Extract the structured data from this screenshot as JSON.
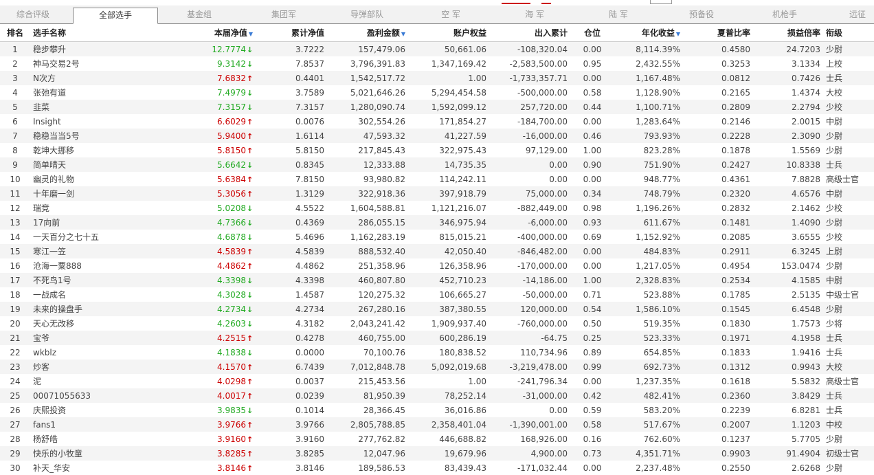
{
  "tabs": [
    {
      "label": "综合评级",
      "active": false
    },
    {
      "label": "全部选手",
      "active": true
    },
    {
      "label": "基金组",
      "active": false
    },
    {
      "label": "集团军",
      "active": false
    },
    {
      "label": "导弹部队",
      "active": false
    },
    {
      "label": "空 军",
      "active": false
    },
    {
      "label": "海 军",
      "active": false
    },
    {
      "label": "陆 军",
      "active": false
    },
    {
      "label": "预备役",
      "active": false
    },
    {
      "label": "机枪手",
      "active": false
    },
    {
      "label": "远征",
      "active": false
    }
  ],
  "columns": [
    {
      "label": "排名",
      "sortable": false
    },
    {
      "label": "选手名称",
      "sortable": false
    },
    {
      "label": "本届净值",
      "sortable": true
    },
    {
      "label": "累计净值",
      "sortable": false
    },
    {
      "label": "盈利金额",
      "sortable": true
    },
    {
      "label": "账户权益",
      "sortable": false
    },
    {
      "label": "出入累计",
      "sortable": false
    },
    {
      "label": "仓位",
      "sortable": false
    },
    {
      "label": "年化收益",
      "sortable": true
    },
    {
      "label": "夏普比率",
      "sortable": false
    },
    {
      "label": "损益倍率",
      "sortable": false
    },
    {
      "label": "衔级",
      "sortable": false
    }
  ],
  "sort_icon": "triangle-down",
  "trend_colors": {
    "up": "#cc0000",
    "down": "#22aa22"
  },
  "rows": [
    {
      "rank": "1",
      "name": "稳步攀升",
      "nav": "12.7774",
      "trend": "down",
      "cum_nav": "3.7222",
      "profit": "157,479.06",
      "equity": "50,661.06",
      "flow": "-108,320.04",
      "position": "0.00",
      "annual": "8,114.39%",
      "sharpe": "0.4580",
      "pl_ratio": "24.7203",
      "rank_title": "少尉"
    },
    {
      "rank": "2",
      "name": "神马交易2号",
      "nav": "9.3142",
      "trend": "down",
      "cum_nav": "7.8537",
      "profit": "3,796,391.83",
      "equity": "1,347,169.42",
      "flow": "-2,583,500.00",
      "position": "0.95",
      "annual": "2,432.55%",
      "sharpe": "0.3253",
      "pl_ratio": "3.1334",
      "rank_title": "上校"
    },
    {
      "rank": "3",
      "name": "N次方",
      "nav": "7.6832",
      "trend": "up",
      "cum_nav": "0.4401",
      "profit": "1,542,517.72",
      "equity": "1.00",
      "flow": "-1,733,357.71",
      "position": "0.00",
      "annual": "1,167.48%",
      "sharpe": "0.0812",
      "pl_ratio": "0.7426",
      "rank_title": "士兵"
    },
    {
      "rank": "4",
      "name": "张弛有道",
      "nav": "7.4979",
      "trend": "down",
      "cum_nav": "3.7589",
      "profit": "5,021,646.26",
      "equity": "5,294,454.58",
      "flow": "-500,000.00",
      "position": "0.58",
      "annual": "1,128.90%",
      "sharpe": "0.2165",
      "pl_ratio": "1.4374",
      "rank_title": "大校"
    },
    {
      "rank": "5",
      "name": "韭菜",
      "nav": "7.3157",
      "trend": "down",
      "cum_nav": "7.3157",
      "profit": "1,280,090.74",
      "equity": "1,592,099.12",
      "flow": "257,720.00",
      "position": "0.44",
      "annual": "1,100.71%",
      "sharpe": "0.2809",
      "pl_ratio": "2.2794",
      "rank_title": "少校"
    },
    {
      "rank": "6",
      "name": "Insight",
      "nav": "6.6029",
      "trend": "up",
      "cum_nav": "0.0076",
      "profit": "302,554.26",
      "equity": "171,854.27",
      "flow": "-184,700.00",
      "position": "0.00",
      "annual": "1,283.64%",
      "sharpe": "0.2146",
      "pl_ratio": "2.0015",
      "rank_title": "中尉"
    },
    {
      "rank": "7",
      "name": "稳稳当当5号",
      "nav": "5.9400",
      "trend": "up",
      "cum_nav": "1.6114",
      "profit": "47,593.32",
      "equity": "41,227.59",
      "flow": "-16,000.00",
      "position": "0.46",
      "annual": "793.93%",
      "sharpe": "0.2228",
      "pl_ratio": "2.3090",
      "rank_title": "少尉"
    },
    {
      "rank": "8",
      "name": "乾坤大挪移",
      "nav": "5.8150",
      "trend": "up",
      "cum_nav": "5.8150",
      "profit": "217,845.43",
      "equity": "322,975.43",
      "flow": "97,129.00",
      "position": "1.00",
      "annual": "823.28%",
      "sharpe": "0.1878",
      "pl_ratio": "1.5569",
      "rank_title": "少尉"
    },
    {
      "rank": "9",
      "name": "简单晴天",
      "nav": "5.6642",
      "trend": "down",
      "cum_nav": "0.8345",
      "profit": "12,333.88",
      "equity": "14,735.35",
      "flow": "0.00",
      "position": "0.90",
      "annual": "751.90%",
      "sharpe": "0.2427",
      "pl_ratio": "10.8338",
      "rank_title": "士兵"
    },
    {
      "rank": "10",
      "name": "幽灵的礼物",
      "nav": "5.6384",
      "trend": "up",
      "cum_nav": "7.8150",
      "profit": "93,980.82",
      "equity": "114,242.11",
      "flow": "0.00",
      "position": "0.00",
      "annual": "948.77%",
      "sharpe": "0.4361",
      "pl_ratio": "7.8828",
      "rank_title": "高级士官"
    },
    {
      "rank": "11",
      "name": "十年磨一剑",
      "nav": "5.3056",
      "trend": "up",
      "cum_nav": "1.3129",
      "profit": "322,918.36",
      "equity": "397,918.79",
      "flow": "75,000.00",
      "position": "0.34",
      "annual": "748.79%",
      "sharpe": "0.2320",
      "pl_ratio": "4.6576",
      "rank_title": "中尉"
    },
    {
      "rank": "12",
      "name": "瑞竞",
      "nav": "5.0208",
      "trend": "down",
      "cum_nav": "4.5522",
      "profit": "1,604,588.81",
      "equity": "1,121,216.07",
      "flow": "-882,449.00",
      "position": "0.98",
      "annual": "1,196.26%",
      "sharpe": "0.2832",
      "pl_ratio": "2.1462",
      "rank_title": "少校"
    },
    {
      "rank": "13",
      "name": "17向前",
      "nav": "4.7366",
      "trend": "down",
      "cum_nav": "0.4369",
      "profit": "286,055.15",
      "equity": "346,975.94",
      "flow": "-6,000.00",
      "position": "0.93",
      "annual": "611.67%",
      "sharpe": "0.1481",
      "pl_ratio": "1.4090",
      "rank_title": "少尉"
    },
    {
      "rank": "14",
      "name": "一天百分之七十五",
      "nav": "4.6878",
      "trend": "down",
      "cum_nav": "5.4696",
      "profit": "1,162,283.19",
      "equity": "815,015.21",
      "flow": "-400,000.00",
      "position": "0.69",
      "annual": "1,152.92%",
      "sharpe": "0.2085",
      "pl_ratio": "3.6555",
      "rank_title": "少校"
    },
    {
      "rank": "15",
      "name": "寒江一笠",
      "nav": "4.5839",
      "trend": "up",
      "cum_nav": "4.5839",
      "profit": "888,532.40",
      "equity": "42,050.40",
      "flow": "-846,482.00",
      "position": "0.00",
      "annual": "484.83%",
      "sharpe": "0.2911",
      "pl_ratio": "6.3245",
      "rank_title": "上尉"
    },
    {
      "rank": "16",
      "name": "沧海一粟888",
      "nav": "4.4862",
      "trend": "up",
      "cum_nav": "4.4862",
      "profit": "251,358.96",
      "equity": "126,358.96",
      "flow": "-170,000.00",
      "position": "0.00",
      "annual": "1,217.05%",
      "sharpe": "0.4954",
      "pl_ratio": "153.0474",
      "rank_title": "少尉"
    },
    {
      "rank": "17",
      "name": "不死鸟1号",
      "nav": "4.3398",
      "trend": "down",
      "cum_nav": "4.3398",
      "profit": "460,807.80",
      "equity": "452,710.23",
      "flow": "-14,186.00",
      "position": "1.00",
      "annual": "2,328.83%",
      "sharpe": "0.2534",
      "pl_ratio": "4.1585",
      "rank_title": "中尉"
    },
    {
      "rank": "18",
      "name": "一战成名",
      "nav": "4.3028",
      "trend": "down",
      "cum_nav": "1.4587",
      "profit": "120,275.32",
      "equity": "106,665.27",
      "flow": "-50,000.00",
      "position": "0.71",
      "annual": "523.88%",
      "sharpe": "0.1785",
      "pl_ratio": "2.5135",
      "rank_title": "中级士官"
    },
    {
      "rank": "19",
      "name": "未来的操盘手",
      "nav": "4.2734",
      "trend": "down",
      "cum_nav": "4.2734",
      "profit": "267,280.16",
      "equity": "387,380.55",
      "flow": "120,000.00",
      "position": "0.54",
      "annual": "1,586.10%",
      "sharpe": "0.1545",
      "pl_ratio": "6.4548",
      "rank_title": "少尉"
    },
    {
      "rank": "20",
      "name": "天心无改移",
      "nav": "4.2603",
      "trend": "down",
      "cum_nav": "4.3182",
      "profit": "2,043,241.42",
      "equity": "1,909,937.40",
      "flow": "-760,000.00",
      "position": "0.50",
      "annual": "519.35%",
      "sharpe": "0.1830",
      "pl_ratio": "1.7573",
      "rank_title": "少将"
    },
    {
      "rank": "21",
      "name": "宝爷",
      "nav": "4.2515",
      "trend": "up",
      "cum_nav": "0.4278",
      "profit": "460,755.00",
      "equity": "600,286.19",
      "flow": "-64.75",
      "position": "0.25",
      "annual": "523.33%",
      "sharpe": "0.1971",
      "pl_ratio": "4.1958",
      "rank_title": "士兵"
    },
    {
      "rank": "22",
      "name": "wkblz",
      "nav": "4.1838",
      "trend": "down",
      "cum_nav": "0.0000",
      "profit": "70,100.76",
      "equity": "180,838.52",
      "flow": "110,734.96",
      "position": "0.89",
      "annual": "654.85%",
      "sharpe": "0.1833",
      "pl_ratio": "1.9416",
      "rank_title": "士兵"
    },
    {
      "rank": "23",
      "name": "炒客",
      "nav": "4.1570",
      "trend": "up",
      "cum_nav": "6.7439",
      "profit": "7,012,848.78",
      "equity": "5,092,019.68",
      "flow": "-3,219,478.00",
      "position": "0.99",
      "annual": "692.73%",
      "sharpe": "0.1312",
      "pl_ratio": "0.9943",
      "rank_title": "大校"
    },
    {
      "rank": "24",
      "name": "泥",
      "nav": "4.0298",
      "trend": "up",
      "cum_nav": "0.0037",
      "profit": "215,453.56",
      "equity": "1.00",
      "flow": "-241,796.34",
      "position": "0.00",
      "annual": "1,237.35%",
      "sharpe": "0.1618",
      "pl_ratio": "5.5832",
      "rank_title": "高级士官"
    },
    {
      "rank": "25",
      "name": "00071055633",
      "nav": "4.0017",
      "trend": "up",
      "cum_nav": "0.0239",
      "profit": "81,950.39",
      "equity": "78,252.14",
      "flow": "-31,000.00",
      "position": "0.42",
      "annual": "482.41%",
      "sharpe": "0.2360",
      "pl_ratio": "3.8429",
      "rank_title": "士兵"
    },
    {
      "rank": "26",
      "name": "庆熙投资",
      "nav": "3.9835",
      "trend": "down",
      "cum_nav": "0.1014",
      "profit": "28,366.45",
      "equity": "36,016.86",
      "flow": "0.00",
      "position": "0.59",
      "annual": "583.20%",
      "sharpe": "0.2239",
      "pl_ratio": "6.8281",
      "rank_title": "士兵"
    },
    {
      "rank": "27",
      "name": "fans1",
      "nav": "3.9766",
      "trend": "up",
      "cum_nav": "3.9766",
      "profit": "2,805,788.85",
      "equity": "2,358,401.04",
      "flow": "-1,390,001.00",
      "position": "0.58",
      "annual": "517.67%",
      "sharpe": "0.2007",
      "pl_ratio": "1.1203",
      "rank_title": "中校"
    },
    {
      "rank": "28",
      "name": "杨舒皓",
      "nav": "3.9160",
      "trend": "up",
      "cum_nav": "3.9160",
      "profit": "277,762.82",
      "equity": "446,688.82",
      "flow": "168,926.00",
      "position": "0.16",
      "annual": "762.60%",
      "sharpe": "0.1237",
      "pl_ratio": "5.7705",
      "rank_title": "少尉"
    },
    {
      "rank": "29",
      "name": "快乐的小牧童",
      "nav": "3.8285",
      "trend": "up",
      "cum_nav": "3.8285",
      "profit": "12,047.96",
      "equity": "19,679.96",
      "flow": "4,900.00",
      "position": "0.73",
      "annual": "4,351.71%",
      "sharpe": "0.9903",
      "pl_ratio": "91.4904",
      "rank_title": "初级士官"
    },
    {
      "rank": "30",
      "name": "补天_华安",
      "nav": "3.8146",
      "trend": "up",
      "cum_nav": "3.8146",
      "profit": "189,586.53",
      "equity": "83,439.43",
      "flow": "-171,032.44",
      "position": "0.00",
      "annual": "2,237.48%",
      "sharpe": "0.2550",
      "pl_ratio": "2.6268",
      "rank_title": "少尉"
    }
  ]
}
